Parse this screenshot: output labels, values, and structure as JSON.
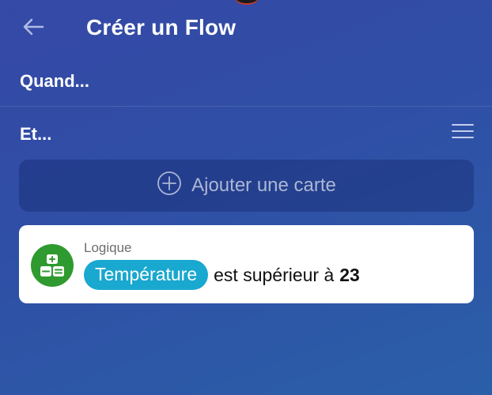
{
  "header": {
    "title": "Créer un Flow",
    "back_icon": "arrow-left-icon"
  },
  "sections": {
    "when_title": "Quand...",
    "and_title": "Et...",
    "menu_icon": "hamburger-menu-icon"
  },
  "add_card": {
    "label": "Ajouter une carte",
    "icon": "plus-circle-icon"
  },
  "condition_card": {
    "category": "Logique",
    "icon": "calculator-icon",
    "token": "Température",
    "text": "est supérieur à",
    "value": "23",
    "colors": {
      "icon_bg": "#2f9a2f",
      "token_bg": "#19a8cf"
    }
  }
}
